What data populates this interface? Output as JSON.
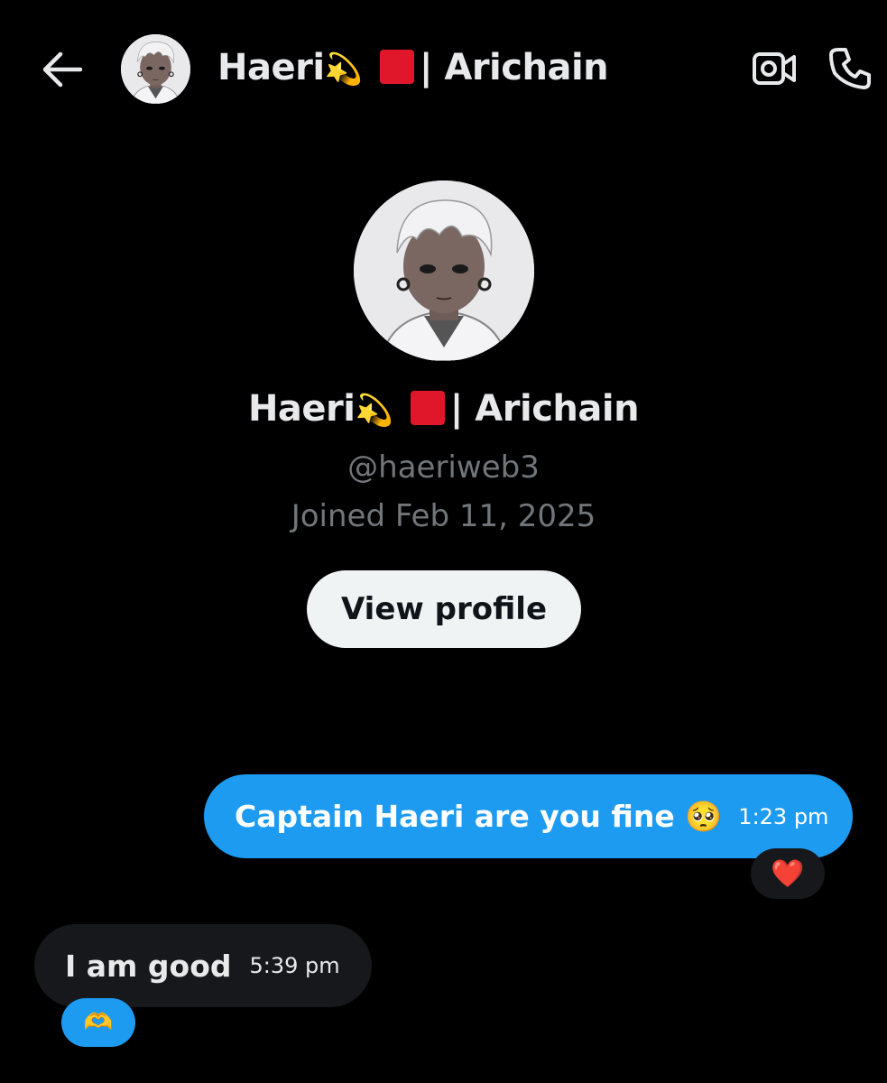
{
  "header": {
    "back_icon": "arrow-left-icon",
    "title_name": "Haeri",
    "title_emoji_star": "💫",
    "title_emoji_square": "🟥",
    "title_suffix": "| Arichain",
    "video_icon": "video-camera-icon",
    "call_icon": "phone-icon"
  },
  "profile": {
    "name": "Haeri",
    "name_emoji_star": "💫",
    "name_emoji_square": "🟥",
    "name_suffix": "| Arichain",
    "handle": "@haeriweb3",
    "joined": "Joined Feb 11, 2025",
    "view_profile_label": "View profile"
  },
  "messages": [
    {
      "direction": "outgoing",
      "text": "Captain Haeri are you fine",
      "emoji": "🥺",
      "time": "1:23 pm",
      "reaction": "❤️"
    },
    {
      "direction": "incoming",
      "text": "I am good",
      "time": "5:39 pm",
      "reaction": "🫶"
    }
  ],
  "colors": {
    "background": "#000000",
    "accent": "#1d9bf0",
    "incoming_bubble": "#16181c",
    "secondary_text": "#71767b",
    "primary_text": "#e7e9ea",
    "button_bg": "#eff3f4"
  }
}
